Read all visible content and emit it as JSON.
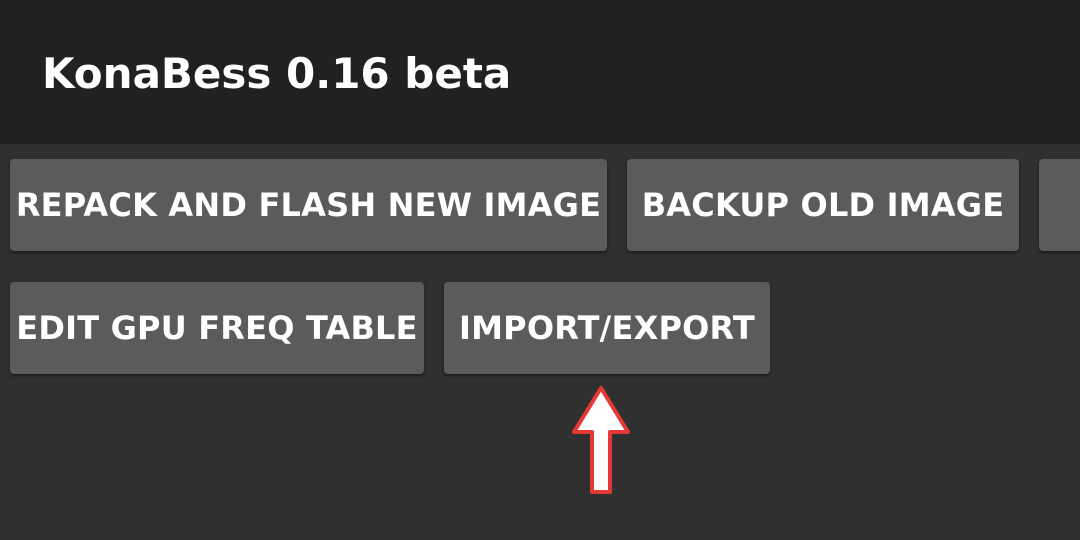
{
  "app_bar": {
    "title": "KonaBess 0.16 beta"
  },
  "buttons": {
    "repack_flash": "REPACK AND FLASH NEW IMAGE",
    "backup_old": "BACKUP OLD IMAGE",
    "edit_gpu_freq": "EDIT GPU FREQ TABLE",
    "import_export": "IMPORT/EXPORT"
  },
  "annotation": {
    "icon": "up-arrow-icon",
    "color": "#e53935"
  }
}
